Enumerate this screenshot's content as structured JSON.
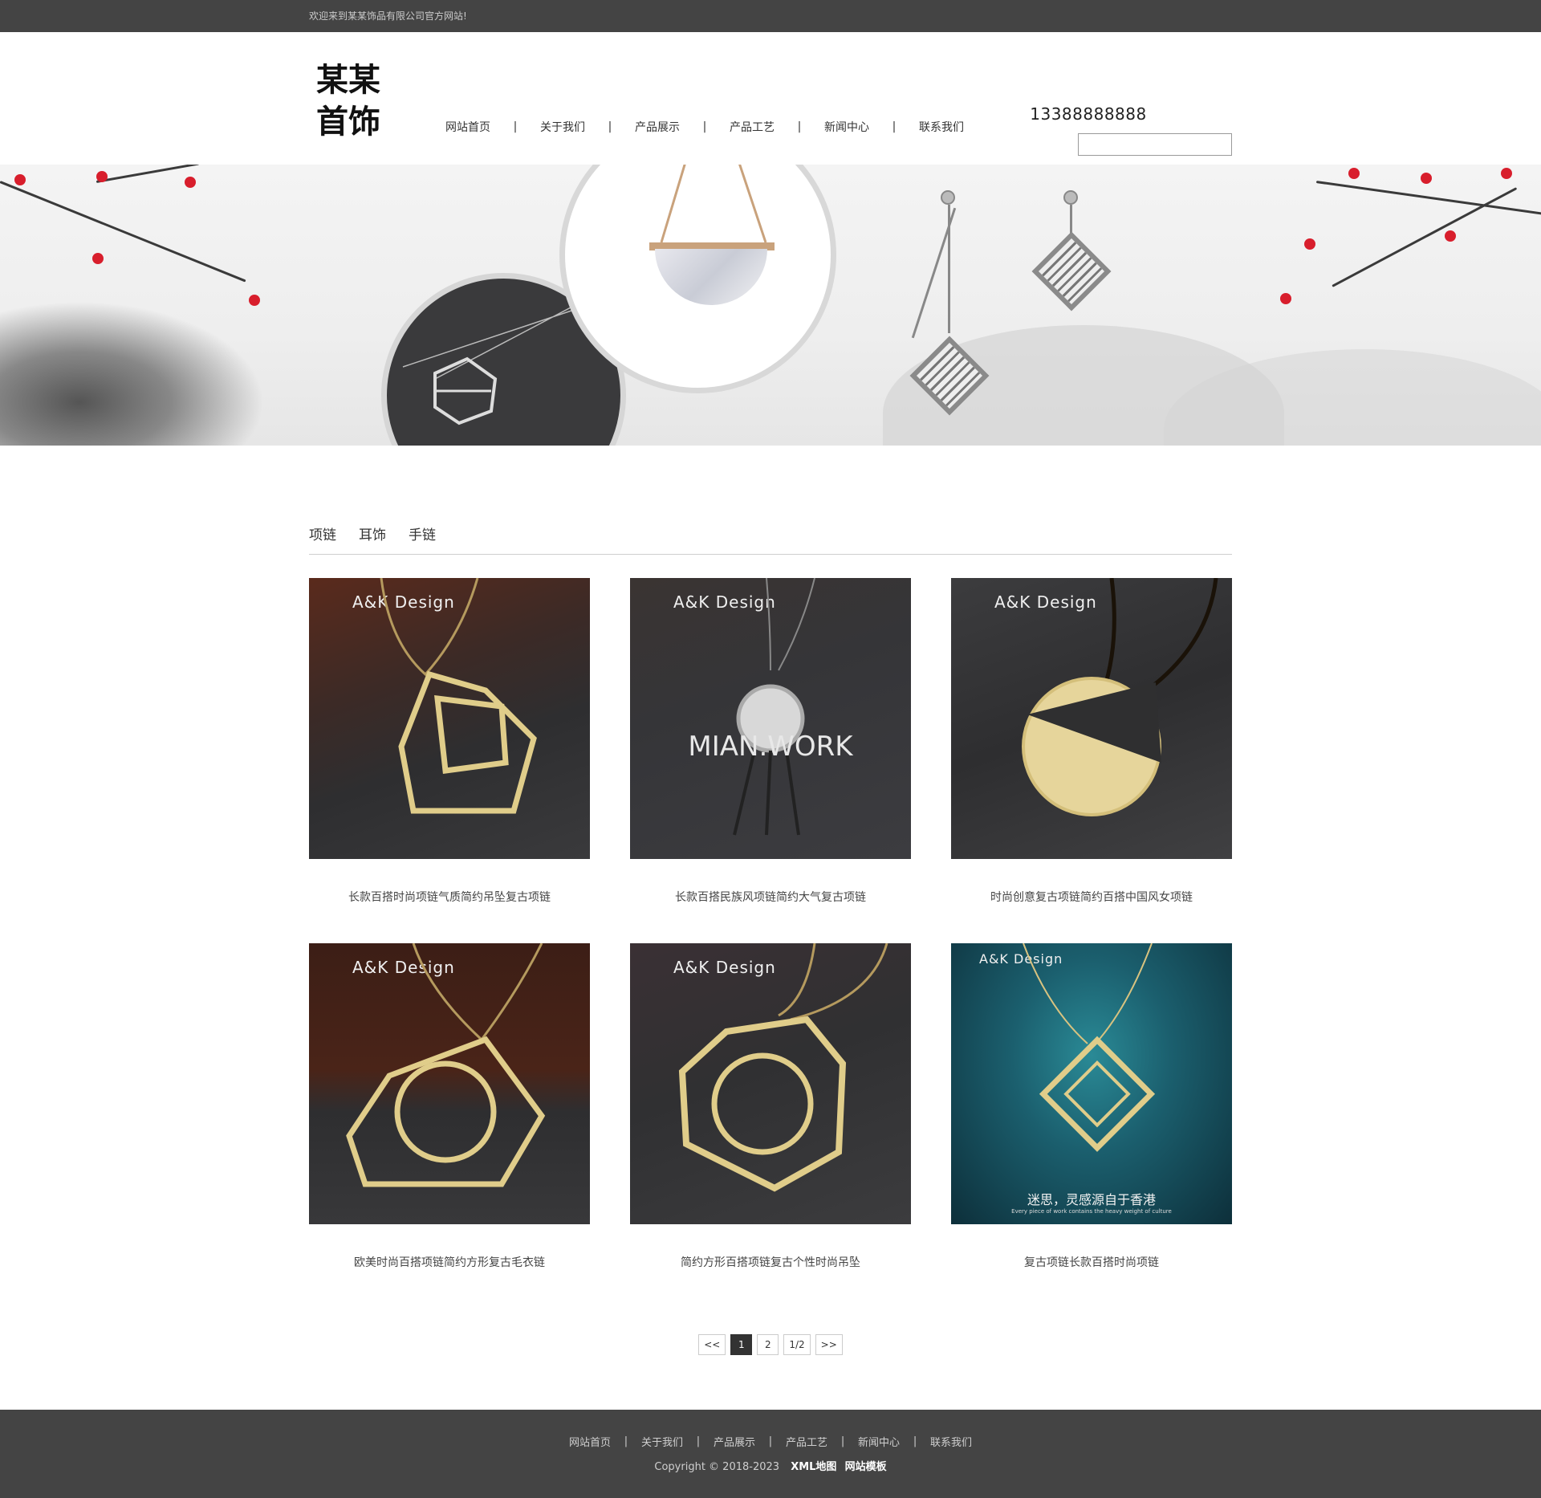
{
  "topbar": {
    "welcome": "欢迎来到某某饰品有限公司官方网站!"
  },
  "header": {
    "logo_line1": "某某",
    "logo_line2": "首饰",
    "phone": "13388888888",
    "search_placeholder": ""
  },
  "nav": [
    {
      "label": "网站首页"
    },
    {
      "label": "关于我们"
    },
    {
      "label": "产品展示"
    },
    {
      "label": "产品工艺"
    },
    {
      "label": "新闻中心"
    },
    {
      "label": "联系我们"
    }
  ],
  "tabs": [
    {
      "label": "项链"
    },
    {
      "label": "耳饰"
    },
    {
      "label": "手链"
    }
  ],
  "products": [
    {
      "title": "长款百搭时尚项链气质简约吊坠复古项链",
      "brand": "A&K Design"
    },
    {
      "title": "长款百搭民族风项链简约大气复古项链",
      "brand": "A&K Design",
      "overlay": "MIAN.WORK"
    },
    {
      "title": "时尚创意复古项链简约百搭中国风女项链",
      "brand": "A&K Design"
    },
    {
      "title": "欧美时尚百搭项链简约方形复古毛衣链",
      "brand": "A&K Design"
    },
    {
      "title": "简约方形百搭项链复古个性时尚吊坠",
      "brand": "A&K Design"
    },
    {
      "title": "复古项链长款百搭时尚项链",
      "brand": "A&K Design",
      "caption": "迷思，灵感源自于香港",
      "caption_sub": "Every piece of work contains the heavy weight of culture"
    }
  ],
  "pager": {
    "prev": "<<",
    "pages": [
      "1",
      "2"
    ],
    "current": "1",
    "info": "1/2",
    "next": ">>"
  },
  "footer": {
    "nav": [
      "网站首页",
      "关于我们",
      "产品展示",
      "产品工艺",
      "新闻中心",
      "联系我们"
    ],
    "copyright": "Copyright © 2018-2023",
    "link1": "XML地图",
    "link2": "网站模板"
  },
  "colors": {
    "topbar": "#444444",
    "footer": "#444444",
    "gold": "#e0cd8a",
    "blossom": "#d81e2c"
  }
}
